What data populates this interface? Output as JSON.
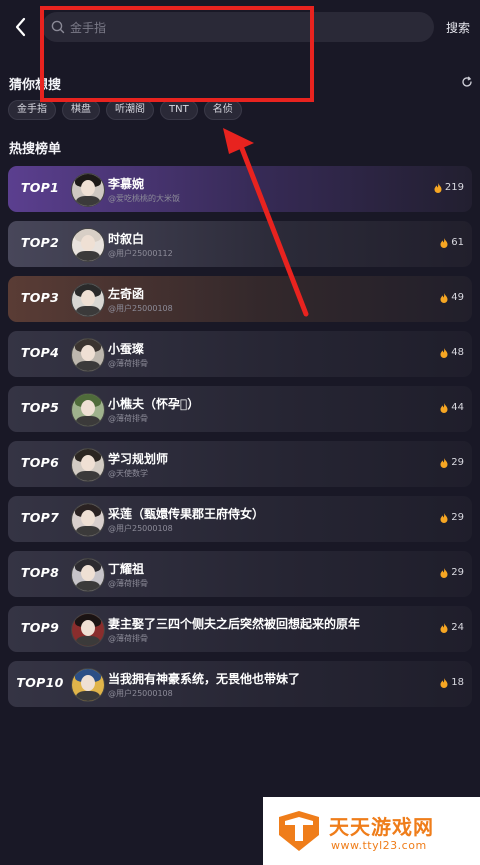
{
  "search": {
    "placeholder": "金手指",
    "button_label": "搜索"
  },
  "guess": {
    "title": "猜你想搜",
    "tags": [
      "金手指",
      "棋盘",
      "听潮阁",
      "TNT",
      "名侦"
    ]
  },
  "hot": {
    "title": "热搜榜单",
    "items": [
      {
        "rank": "TOP1",
        "name": "李慕婉",
        "sub": "@爱吃桃桃的大米饭",
        "heat": "219",
        "avatar_hair": "#1d1a18",
        "avatar_bg": "#cfc8c2"
      },
      {
        "rank": "TOP2",
        "name": "时叙白",
        "sub": "@用户25000112",
        "heat": "61",
        "avatar_hair": "#d8cfc6",
        "avatar_bg": "#e8e2dd"
      },
      {
        "rank": "TOP3",
        "name": "左奇函",
        "sub": "@用户25000108",
        "heat": "49",
        "avatar_hair": "#2a2a2a",
        "avatar_bg": "#d9d7d3"
      },
      {
        "rank": "TOP4",
        "name": "小蚕璨",
        "sub": "@薄荷排骨",
        "heat": "48",
        "avatar_hair": "#3b3430",
        "avatar_bg": "#bdb7ae"
      },
      {
        "rank": "TOP5",
        "name": "小樵夫（怀孕\u0000）",
        "sub": "@薄荷排骨",
        "heat": "44",
        "avatar_hair": "#4f6b3a",
        "avatar_bg": "#9fb28d"
      },
      {
        "rank": "TOP6",
        "name": "学习规划师",
        "sub": "@天使数学",
        "heat": "29",
        "avatar_hair": "#2b2622",
        "avatar_bg": "#d2cbc3"
      },
      {
        "rank": "TOP7",
        "name": "采莲（甄嬛传果郡王府侍女）",
        "sub": "@用户25000108",
        "heat": "29",
        "avatar_hair": "#2a2222",
        "avatar_bg": "#d8cfcd"
      },
      {
        "rank": "TOP8",
        "name": "丁耀祖",
        "sub": "@薄荷排骨",
        "heat": "29",
        "avatar_hair": "#2c2a2f",
        "avatar_bg": "#c7c4c9"
      },
      {
        "rank": "TOP9",
        "name": "妻主娶了三四个侧夫之后突然被回想起来的原年",
        "sub": "@薄荷排骨",
        "heat": "24",
        "avatar_hair": "#1a1313",
        "avatar_bg": "#8a2d2d"
      },
      {
        "rank": "TOP10",
        "name": "当我拥有神豪系统，无畏他也带妹了",
        "sub": "@用户25000108",
        "heat": "18",
        "avatar_hair": "#2c4f86",
        "avatar_bg": "#e0b44a"
      }
    ]
  },
  "watermark": {
    "title": "天天游戏网",
    "url": "www.ttyl23.com"
  },
  "colors": {
    "background": "#191826",
    "annotation": "#e8231f",
    "heat_icon": "#f6a623",
    "watermark": "#ef7d1a"
  }
}
